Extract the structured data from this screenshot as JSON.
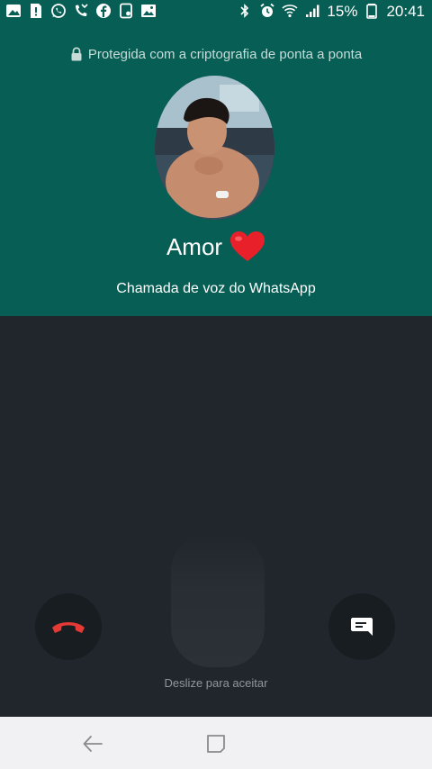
{
  "status_bar": {
    "battery": "15%",
    "time": "20:41",
    "left_icons": [
      "photo-icon",
      "sim-alert-icon",
      "whatsapp-icon",
      "missed-call-icon",
      "facebook-icon",
      "screenshot-icon",
      "gallery-icon"
    ],
    "right_icons": [
      "bluetooth-icon",
      "alarm-icon",
      "wifi-icon",
      "signal-icon",
      "battery-icon"
    ]
  },
  "call": {
    "encryption_text": "Protegida com a criptografia de ponta a ponta",
    "caller_name": "Amor",
    "caller_emoji": "heart-icon",
    "call_type": "Chamada de voz do WhatsApp",
    "swipe_hint": "Deslize para aceitar"
  },
  "colors": {
    "header": "#075e54",
    "body": "#20262c",
    "decline": "#e53935",
    "heart": "#e8202a",
    "nav_bar": "#f1f1f3"
  },
  "nav_bar": {
    "buttons": [
      "back-icon",
      "recents-icon"
    ]
  }
}
